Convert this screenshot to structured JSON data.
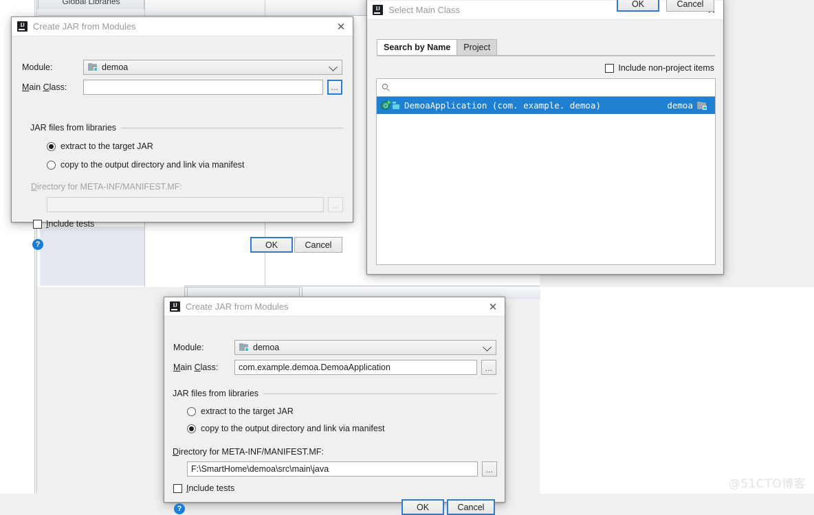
{
  "background": {
    "global_libraries_tab": "Global Libraries"
  },
  "watermark": "@51CTO博客",
  "dialog_create_jar_top": {
    "title": "Create JAR from Modules",
    "close_label": "✕",
    "module_label": "Module:",
    "module_value": "demoa",
    "main_class_label": "Main Class:",
    "main_class_value": "",
    "browse_label": "...",
    "group_title": "JAR files from libraries",
    "radio_extract": "extract to the target JAR",
    "radio_copy": "copy to the output directory and link via manifest",
    "radio_selected": "extract",
    "directory_label": "Directory for META-INF/MANIFEST.MF:",
    "directory_value": "",
    "include_tests_label": "Include tests",
    "include_tests_checked": false,
    "help_label": "?",
    "ok_label": "OK",
    "cancel_label": "Cancel"
  },
  "dialog_select_main_class": {
    "title": "Select Main Class",
    "close_label": "✕",
    "tabs": [
      {
        "label": "Search by Name",
        "active": true
      },
      {
        "label": "Project",
        "active": false
      }
    ],
    "include_non_project_label": "Include non-project items",
    "include_non_project_checked": false,
    "search_value": "",
    "results": [
      {
        "name": "DemoaApplication (com. example. demoa)",
        "module": "demoa",
        "selected": true
      }
    ],
    "ok_label": "OK",
    "cancel_label": "Cancel"
  },
  "dialog_create_jar_bottom": {
    "title": "Create JAR from Modules",
    "close_label": "✕",
    "module_label": "Module:",
    "module_value": "demoa",
    "main_class_label": "Main Class:",
    "main_class_value": "com.example.demoa.DemoaApplication",
    "browse_label": "...",
    "group_title": "JAR files from libraries",
    "radio_extract": "extract to the target JAR",
    "radio_copy": "copy to the output directory and link via manifest",
    "radio_selected": "copy",
    "directory_label": "Directory for META-INF/MANIFEST.MF:",
    "directory_value": "F:\\SmartHome\\demoa\\src\\main\\java",
    "include_tests_label": "Include tests",
    "include_tests_checked": false,
    "help_label": "?",
    "ok_label": "OK",
    "cancel_label": "Cancel"
  }
}
